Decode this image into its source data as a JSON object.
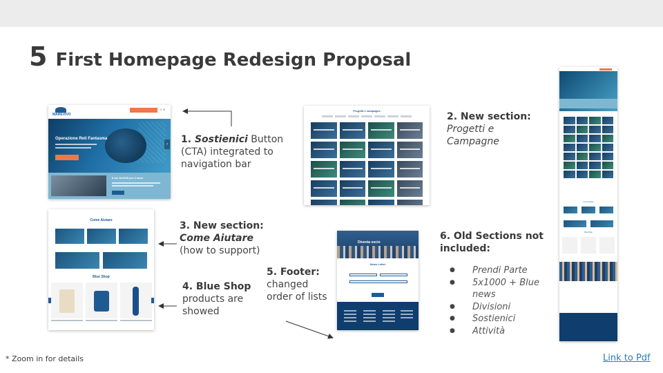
{
  "slide": {
    "number": "5",
    "title": "First Homepage Redesign Proposal"
  },
  "shots": {
    "s1": {
      "logo": "MAREVIVO",
      "hero_title": "Operazione Reti Fantasma",
      "band_title": "Il tuo 5x1000 per il mare"
    },
    "s2": {
      "title": "Progetti e campagne"
    },
    "s3": {
      "section_a": "Come Aiutare",
      "section_b": "Blue Shop"
    },
    "s4": {
      "hero_title": "Diventa socio",
      "newsletter": "News Letter"
    },
    "s5": {
      "section_a": "Come Aiutare",
      "section_b": "Blue Shop"
    }
  },
  "notes": {
    "n1": {
      "num": "1. ",
      "name": "Sostienici",
      "rest": " Button (CTA) integrated to navigation bar"
    },
    "n2": {
      "head": "2. New section:",
      "name": "Progetti e Campagne"
    },
    "n3": {
      "head": "3. New section:",
      "name": "Come Aiutare",
      "rest": "(how to support)"
    },
    "n4": {
      "head": "4. Blue Shop",
      "rest": "products are showed"
    },
    "n5": {
      "head": "5. Footer:",
      "rest": "changed order of lists"
    },
    "n6": {
      "head": "6. Old Sections not included:",
      "items": [
        "Prendi Parte",
        "5x1000 + Blue news",
        "Divisioni",
        "Sostienici",
        "Attività"
      ]
    }
  },
  "footnote": "* Zoom in for details",
  "link": "Link to Pdf",
  "colors": {
    "accent": "#f07846",
    "brand_blue": "#1f5b93",
    "link": "#2a7ab8"
  }
}
